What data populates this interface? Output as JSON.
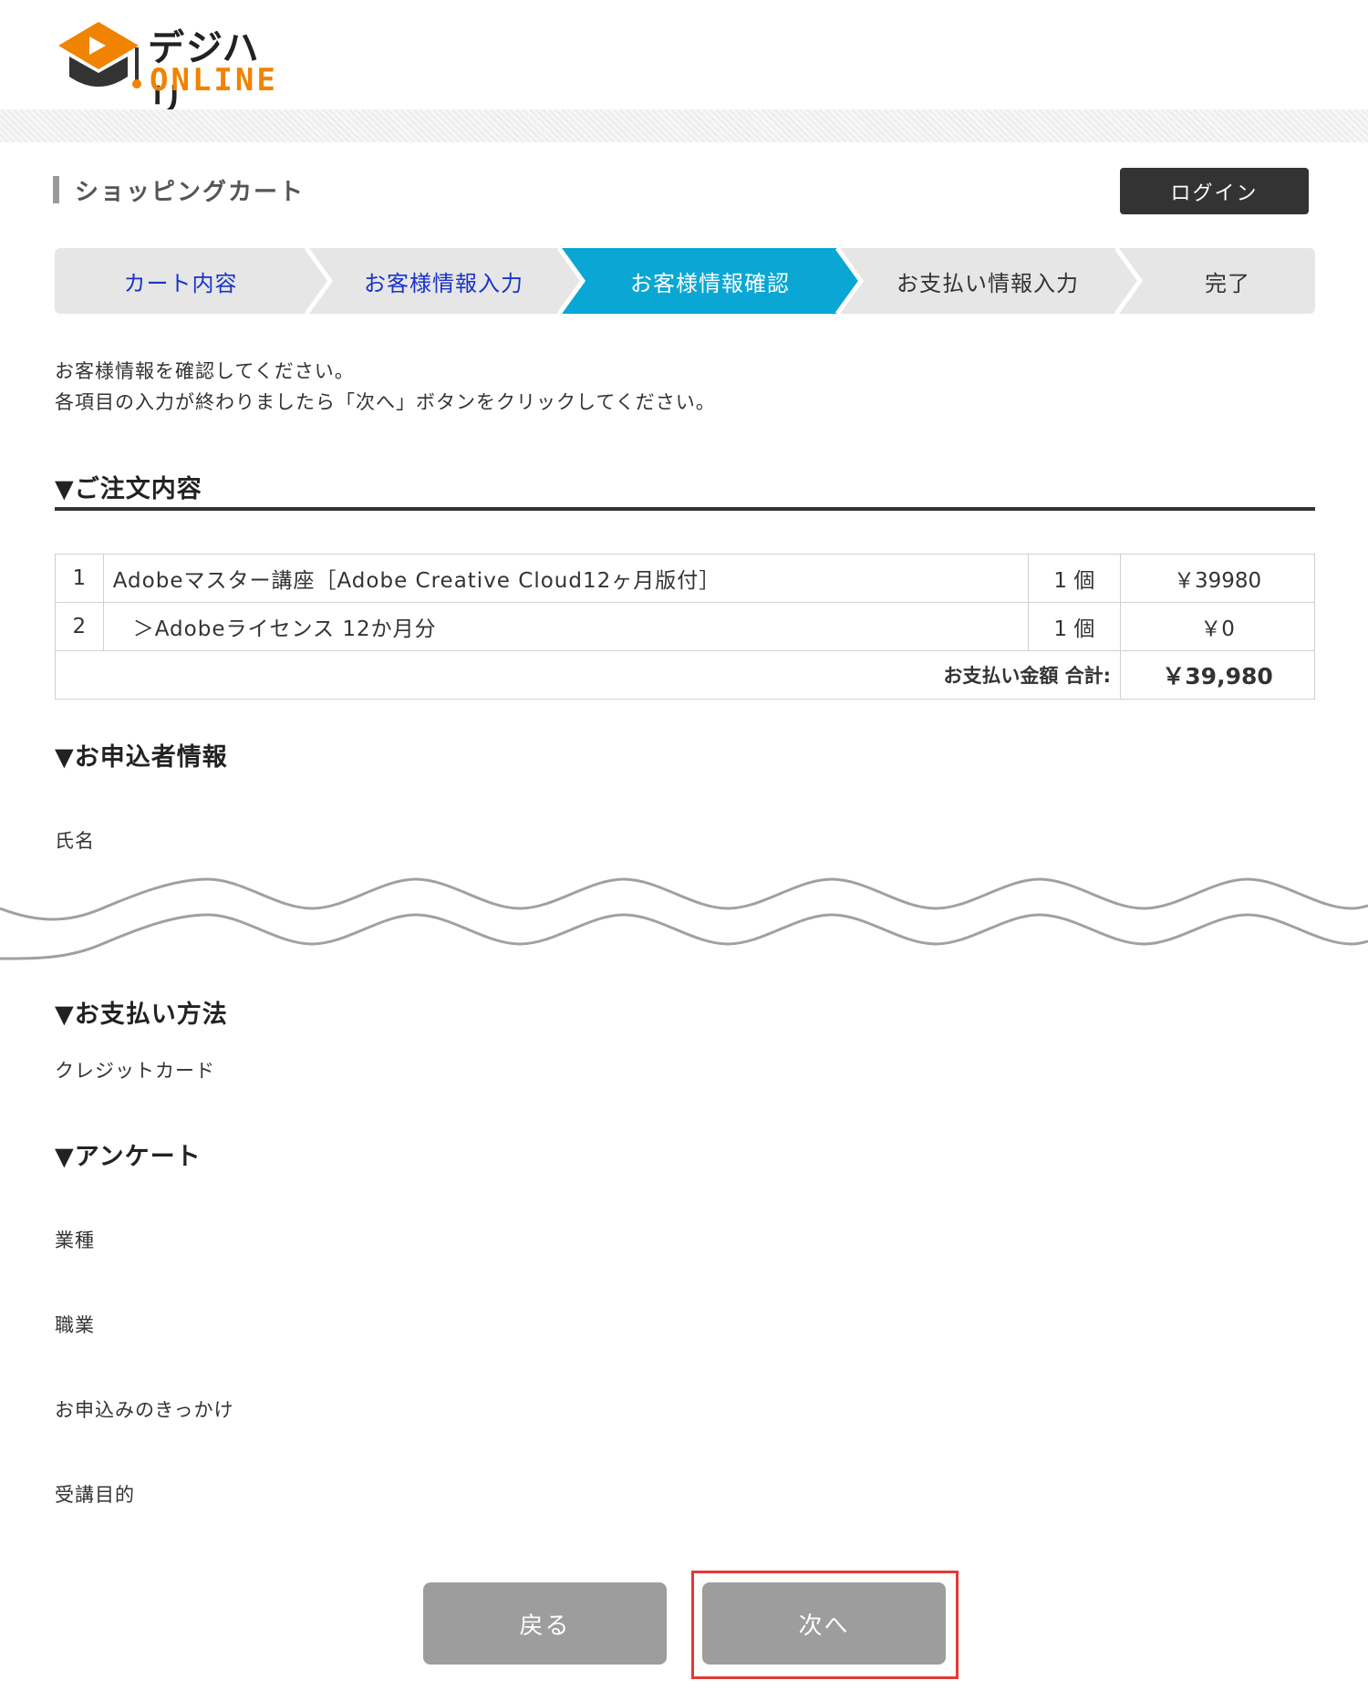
{
  "header": {
    "logo_text_jp": "デジハリ",
    "logo_text_en": "ONLINE",
    "logo_colors": {
      "cap_orange": "#f08300",
      "cap_dark": "#333333"
    }
  },
  "page": {
    "title": "ショッピングカート",
    "login_label": "ログイン"
  },
  "steps": [
    {
      "label": "カート内容",
      "state": "done"
    },
    {
      "label": "お客様情報入力",
      "state": "done"
    },
    {
      "label": "お客様情報確認",
      "state": "current"
    },
    {
      "label": "お支払い情報入力",
      "state": "pending"
    },
    {
      "label": "完了",
      "state": "pending"
    }
  ],
  "intro": {
    "line1": "お客様情報を確認してください。",
    "line2": "各項目の入力が終わりましたら「次へ」ボタンをクリックしてください。"
  },
  "order": {
    "heading": "▼ご注文内容",
    "rows": [
      {
        "no": "1",
        "name": "Adobeマスター講座［Adobe Creative Cloud12ヶ月版付］",
        "qty": "1 個",
        "price": "￥39980"
      },
      {
        "no": "2",
        "name": "＞Adobeライセンス 12か月分",
        "qty": "1 個",
        "price": "￥0"
      }
    ],
    "total_label": "お支払い金額 合計:",
    "total_value": "￥39,980"
  },
  "applicant": {
    "heading": "▼お申込者情報",
    "name_label": "氏名"
  },
  "payment": {
    "heading": "▼お支払い方法",
    "method": "クレジットカード"
  },
  "survey": {
    "heading": "▼アンケート",
    "fields": [
      "業種",
      "職業",
      "お申込みのきっかけ",
      "受講目的"
    ]
  },
  "buttons": {
    "back_label": "戻る",
    "next_label": "次へ"
  },
  "colors": {
    "active_step": "#0aa6d4",
    "done_step_text": "#1a33c8",
    "button_gray": "#9d9d9d",
    "highlight_red": "#e53935"
  }
}
